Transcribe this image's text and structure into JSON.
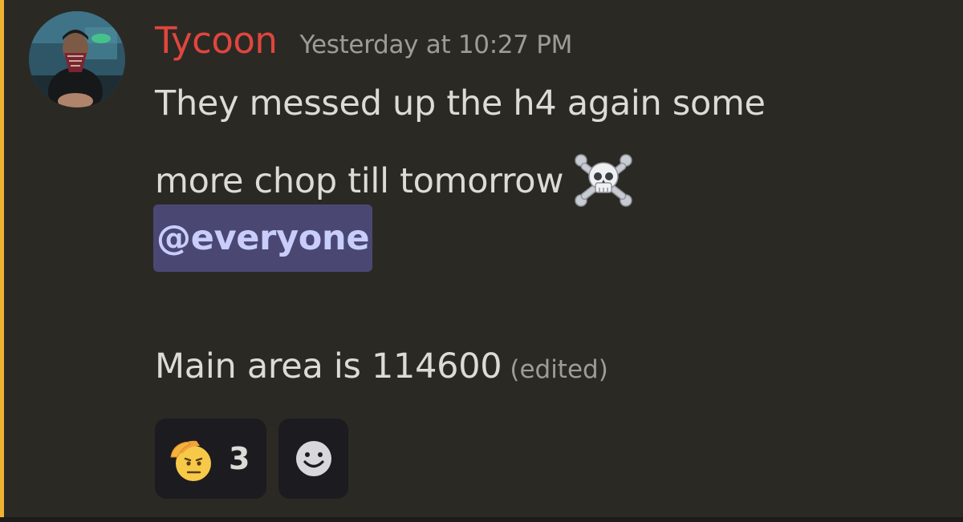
{
  "message": {
    "author": "Tycoon",
    "timestamp": "Yesterday at 10:27 PM",
    "line1": "They messed up the h4 again some",
    "line2": "more chop till tomorrow",
    "mention": "@everyone",
    "line4": "Main area is 114600",
    "edited_label": "(edited)",
    "emoji_line2": "skull-and-crossbones-icon"
  },
  "reactions": [
    {
      "emoji": "saluting-face-icon",
      "count": "3"
    },
    {
      "emoji": "add-reaction-smile-icon"
    }
  ],
  "colors": {
    "background": "#2b2924",
    "mention_bar": "#f0b232",
    "username": "#e0463e",
    "timestamp": "#9d9c98",
    "text": "#dcdbd6",
    "mention_bg": "#4a4873",
    "mention_text": "#c9cdfb",
    "reaction_bg": "#1c1b20"
  }
}
